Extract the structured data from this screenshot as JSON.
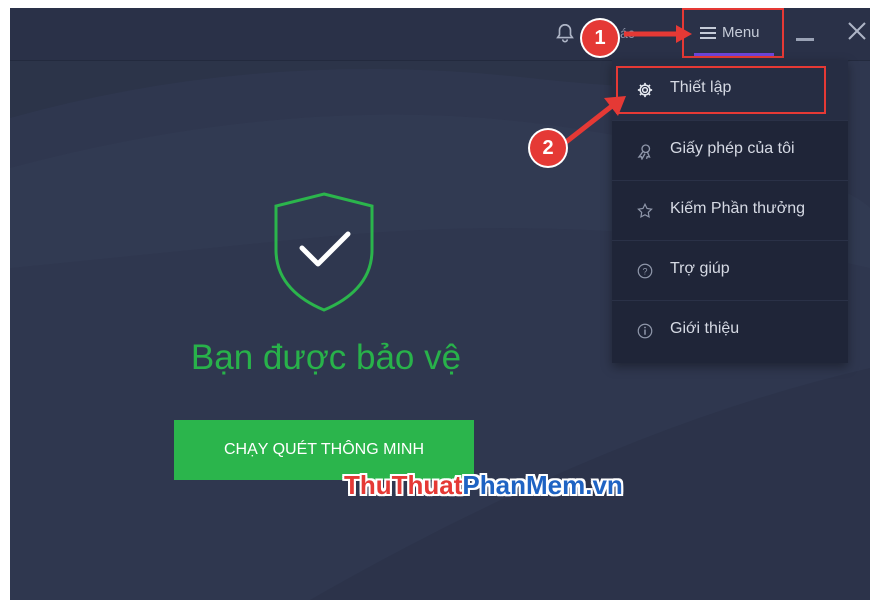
{
  "titlebar": {
    "notification_text": "ác",
    "menu_label": "Menu"
  },
  "dropdown": {
    "items": [
      {
        "label": "Thiết lập",
        "icon": "gear-icon"
      },
      {
        "label": "Giấy phép của tôi",
        "icon": "license-icon"
      },
      {
        "label": "Kiếm Phần thưởng",
        "icon": "star-icon"
      },
      {
        "label": "Trợ giúp",
        "icon": "help-icon"
      },
      {
        "label": "Giới thiệu",
        "icon": "info-icon"
      }
    ]
  },
  "main": {
    "status_text": "Bạn được bảo vệ",
    "scan_button_label": "CHẠY QUÉT THÔNG MINH"
  },
  "annotations": {
    "step1": "1",
    "step2": "2"
  },
  "watermark": {
    "part1": "ThuThuat",
    "part2": "PhanMem",
    "part3": ".vn"
  },
  "colors": {
    "background": "#2f374f",
    "accent_green": "#2bb54c",
    "highlight_red": "#e53935",
    "menu_underline": "#6c46d8"
  }
}
